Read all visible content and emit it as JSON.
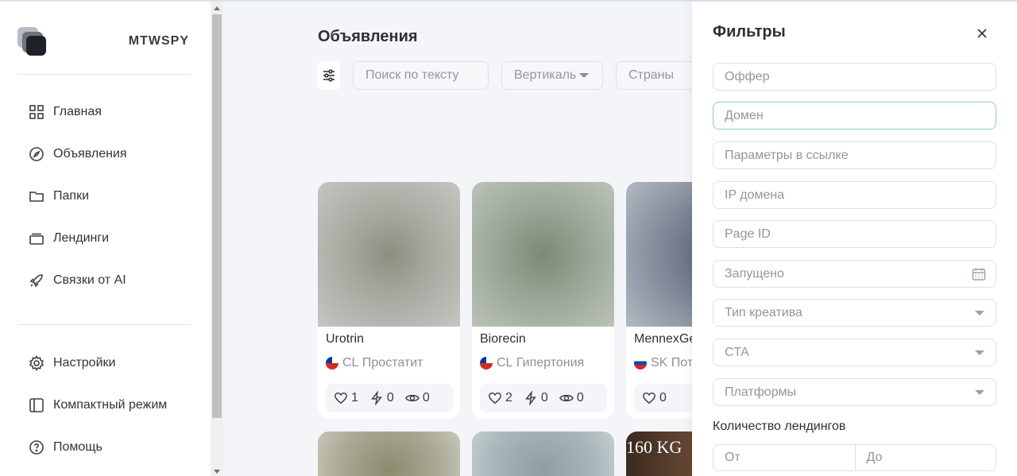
{
  "brand": {
    "name": "MTWSPY"
  },
  "sidebar": {
    "items": [
      {
        "label": "Главная",
        "icon": "grid-icon"
      },
      {
        "label": "Объявления",
        "icon": "compass-icon"
      },
      {
        "label": "Папки",
        "icon": "folder-icon"
      },
      {
        "label": "Лендинги",
        "icon": "layers-icon"
      },
      {
        "label": "Связки от AI",
        "icon": "rocket-icon"
      }
    ],
    "bottom_items": [
      {
        "label": "Настройки",
        "icon": "gear-icon"
      },
      {
        "label": "Компактный режим",
        "icon": "sidebar-panel-icon"
      },
      {
        "label": "Помощь",
        "icon": "help-icon"
      }
    ]
  },
  "main": {
    "title": "Объявления",
    "search_placeholder": "Поиск по тексту",
    "vertical_label": "Вертикаль",
    "countries_label": "Страны"
  },
  "cards": [
    {
      "name": "Urotrin",
      "country": "CL",
      "vertical": "Простатит",
      "likes": "1",
      "clicks": "0",
      "views": "0"
    },
    {
      "name": "Biorecin",
      "country": "CL",
      "vertical": "Гипертония",
      "likes": "2",
      "clicks": "0",
      "views": "0"
    },
    {
      "name": "MennexGe",
      "country": "SK",
      "vertical": "Поте",
      "likes": "0"
    }
  ],
  "card_overlay_text": "160 KG",
  "filters": {
    "title": "Фильтры",
    "offer_placeholder": "Оффер",
    "domain_placeholder": "Домен",
    "link_params_placeholder": "Параметры в ссылке",
    "domain_ip_placeholder": "IP домена",
    "page_id_placeholder": "Page ID",
    "launched_placeholder": "Запущено",
    "creative_type_placeholder": "Тип креатива",
    "cta_placeholder": "CTA",
    "platforms_placeholder": "Платформы",
    "landings_count_label": "Количество лендингов",
    "from_placeholder": "От",
    "to_placeholder": "До"
  },
  "colors": {
    "focus_border": "#8fd0a6",
    "background": "#f4f5f8"
  }
}
